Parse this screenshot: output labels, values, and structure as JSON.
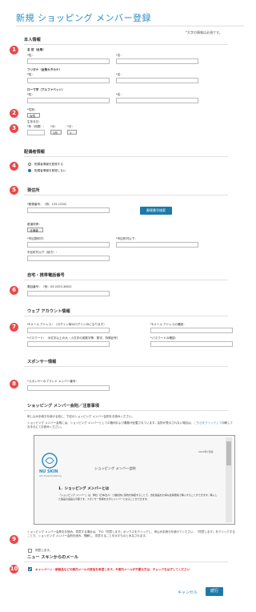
{
  "page": {
    "title": "新規 ショッピング メンバー登録",
    "required_note": "*大字の情報は必須です。"
  },
  "personal": {
    "heading": "本人情報",
    "name_kanji": {
      "label": "名 前（全角）",
      "last": "*姓：",
      "first": "*名："
    },
    "name_kana": {
      "label": "フリガナ（全角カタカナ）",
      "last": "*姓：",
      "first": "*名："
    },
    "name_roman": {
      "label": "ローマ字（アルファベット）",
      "last": "*姓：",
      "first": "*名："
    },
    "gender": {
      "label": "*性別：",
      "value": "女性"
    },
    "birth": {
      "label": "生年月日：",
      "year_label": "*年（西暦）：",
      "month_label": "*月：",
      "day_label": "*日：",
      "month_value": "1月",
      "day_value": "1"
    }
  },
  "delivery": {
    "heading": "配偶者情報",
    "options": [
      "配偶者情報を登録する",
      "配偶者情報を登録しない"
    ]
  },
  "address": {
    "heading": "現住所",
    "postal_label": "*郵便番号：（例：125-1234）",
    "search_button": "郵便番号検索",
    "pref_label": "都道府県：",
    "pref_value": "北海道",
    "city_label": "*市区郡町村：",
    "town_label": "*市区町村以下：",
    "building_label": "市区町村以下（続き）："
  },
  "phone": {
    "heading": "自宅・携帯電話番号",
    "label": "電話番号：（例：03-0325-3803）"
  },
  "account": {
    "heading": "ウェブ アカウント情報",
    "email_label": "*Eメール アドレス：（ログイン時のログインIDになります）",
    "email_confirm_label": "*Eメール アドレスの確認：",
    "password_label": "*パスワード：（8文字以上の大・小文字の英数字等、数字、特殊記号）",
    "password_confirm_label": "*パスワードの確認："
  },
  "sponsor": {
    "heading": "スポンサー情報",
    "label": "*スポンサーのブランド メンバー番号："
  },
  "contract": {
    "heading": "ショッピング メンバー会則／注意事項",
    "intro": "申し込み手続きを続ける前に、下記のショッピング メンバー会則をお読みください。",
    "body1": "ショッピング メンバー会則には、ショッピング メンバーとしての権利および義務が記載されています。会則が表示されない場合は、",
    "link": "こちらをクリックして",
    "body2": "印刷してお手元にてお読みください。",
    "doc": {
      "logo": "NU SKIN",
      "logo_sub": "Let's Create the Best Day",
      "date": "2020年7月版",
      "doc_title": "ショッピング メンバー会則",
      "section": "1．ショッピング メンバーとは",
      "para": "「ショッピング メンバー」は、弊社（日本法人）と継続的に契約を締結することで、当社製品をお得な会員価格で購入することができます。購入した製品の返品も可能です。スポンサー登録をせずにメンバーになることができます。"
    },
    "agree_text": "ショッピング メンバー会則をお読み、同意する場合は、下の「同意します」ボックスをクリックし、申込み手続きを続けてください。「同意します」をクリックすることで、ショッピング メンバー会則を読み、理解し、同意することを示すものとみなされます。",
    "agree_label": "同意します。"
  },
  "mail": {
    "heading": "ニュー スキンからのメール",
    "optin_text": "キャンペーン・新製品などの案内メールの受信を希望します。※案内メールが不要な方は、チェックをはずしてください"
  },
  "actions": {
    "cancel": "キャンセル",
    "submit": "続行"
  },
  "markers": [
    "1",
    "2",
    "3",
    "4",
    "5",
    "6",
    "7",
    "8",
    "9",
    "10"
  ],
  "colors": {
    "accent": "#2b8cc4",
    "marker": "#e84a4a",
    "button": "#1c7aa8",
    "alert": "#d9262b"
  }
}
